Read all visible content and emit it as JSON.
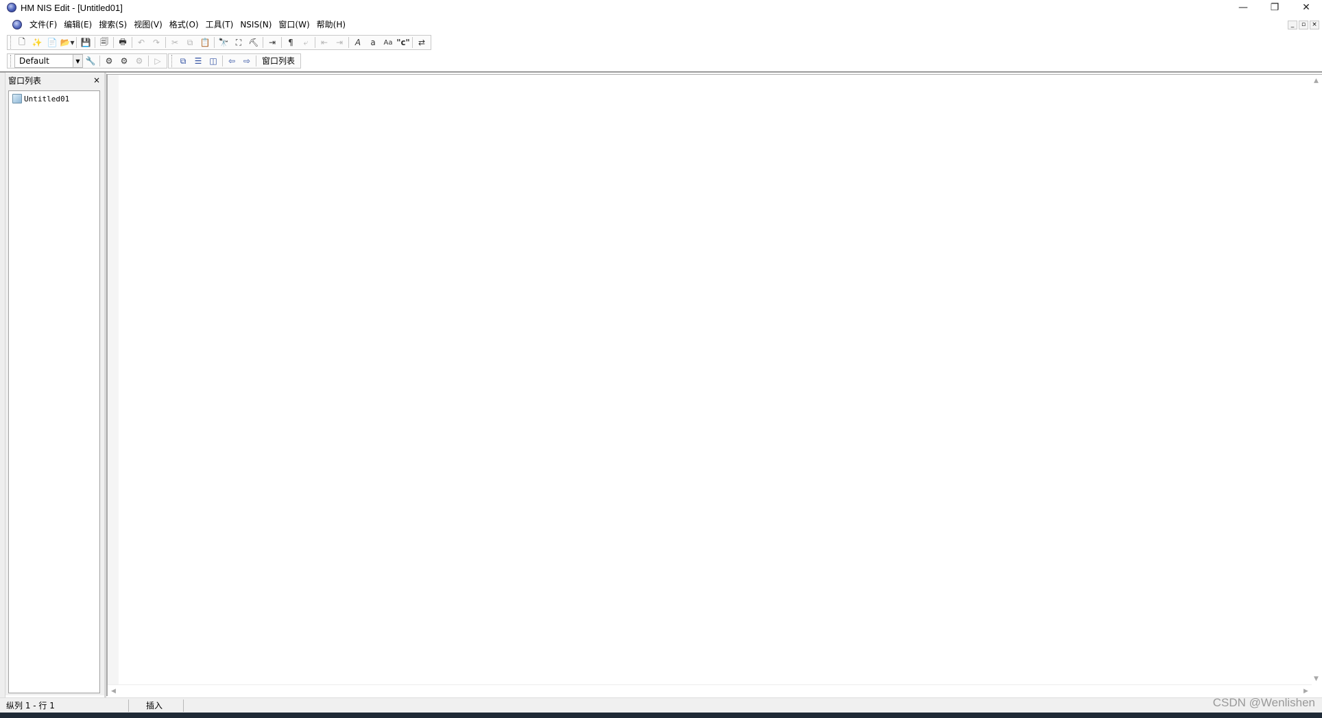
{
  "window": {
    "title": "HM NIS Edit - [Untitled01]",
    "min_glyph": "—",
    "restore_glyph": "❐",
    "close_glyph": "✕"
  },
  "menu": {
    "items": [
      {
        "label": "文件(F)"
      },
      {
        "label": "编辑(E)"
      },
      {
        "label": "搜索(S)"
      },
      {
        "label": "视图(V)"
      },
      {
        "label": "格式(O)"
      },
      {
        "label": "工具(T)"
      },
      {
        "label": "NSIS(N)"
      },
      {
        "label": "窗口(W)"
      },
      {
        "label": "帮助(H)"
      }
    ],
    "mdi_min": "_",
    "mdi_restore": "▫",
    "mdi_close": "×"
  },
  "toolbar2": {
    "profile_select": "Default",
    "window_list_button": "窗口列表"
  },
  "panel": {
    "title": "窗口列表",
    "close_glyph": "×",
    "items": [
      {
        "label": "Untitled01"
      }
    ]
  },
  "statusbar": {
    "position": "纵列 1 - 行 1",
    "mode": "插入"
  },
  "watermark": "CSDN @Wenlishen",
  "colors": {
    "accent_icon": "#4a5fb8",
    "status_bg": "#f0f0f0",
    "taskbar": "#1f2a36"
  }
}
